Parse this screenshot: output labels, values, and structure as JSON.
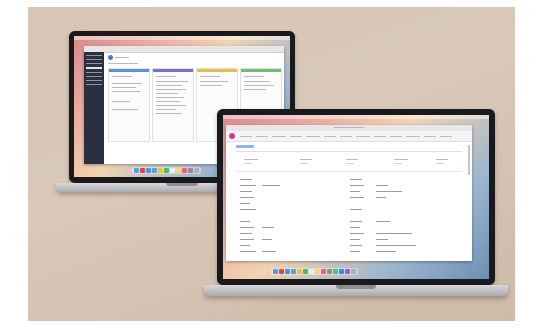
{
  "scene": {
    "background_color": "#d7c6b6",
    "laptops": [
      {
        "position": "back-left",
        "screen_content": "kanban-board"
      },
      {
        "position": "front-right",
        "screen_content": "data-form"
      }
    ],
    "dock_icons": [
      "finder",
      "launchpad",
      "safari",
      "mail",
      "photos",
      "messages",
      "calendar",
      "notes",
      "music",
      "settings",
      "trash"
    ]
  }
}
